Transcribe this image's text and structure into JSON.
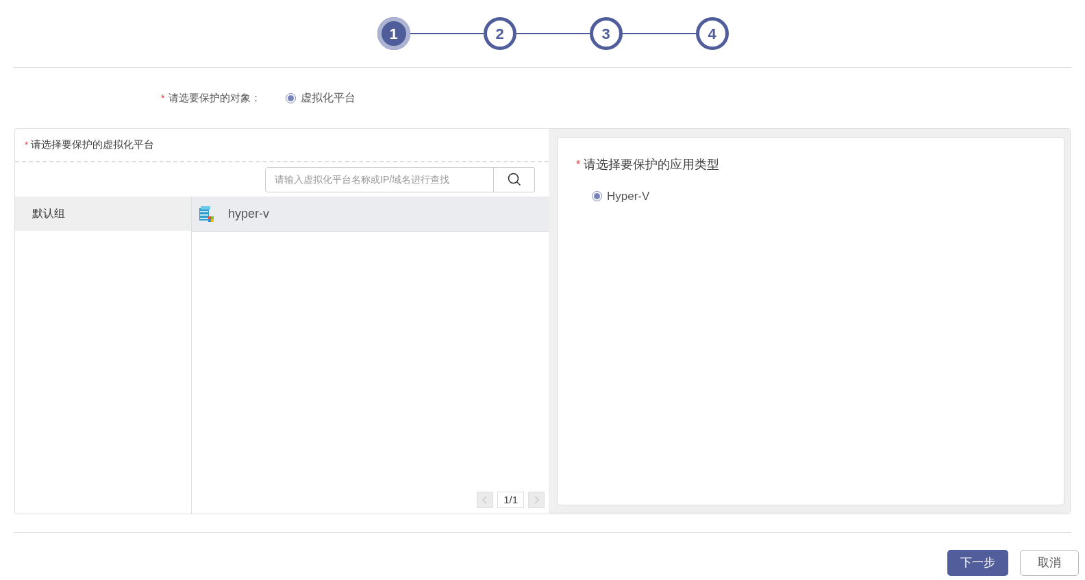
{
  "steps": [
    {
      "label": "1",
      "selected": true
    },
    {
      "label": "2",
      "selected": false
    },
    {
      "label": "3",
      "selected": false
    },
    {
      "label": "4",
      "selected": false
    }
  ],
  "protect_target": {
    "required_mark": "*",
    "label": "请选要保护的对象：",
    "options": [
      {
        "label": "虚拟化平台",
        "selected": true
      }
    ]
  },
  "platform_panel": {
    "required_mark": "*",
    "title": "请选择要保护的虚拟化平台",
    "search": {
      "placeholder": "请输入虚拟化平台名称或IP/域名进行查找"
    },
    "groups": [
      {
        "label": "默认组",
        "selected": true
      }
    ],
    "items": [
      {
        "label": "hyper-v",
        "selected": true
      }
    ],
    "pagination": {
      "page": "1/1"
    }
  },
  "app_panel": {
    "required_mark": "*",
    "title": "请选择要保护的应用类型",
    "options": [
      {
        "label": "Hyper-V",
        "selected": true
      }
    ]
  },
  "buttons": [
    {
      "label": "下一步",
      "kind": "primary"
    },
    {
      "label": "取消",
      "kind": "secondary"
    }
  ]
}
